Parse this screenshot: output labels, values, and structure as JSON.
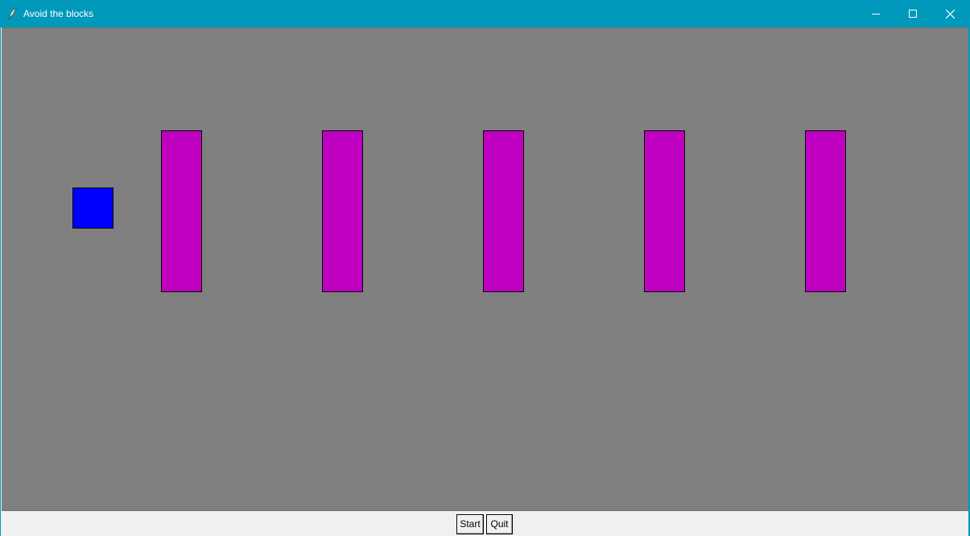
{
  "window": {
    "title": "Avoid the blocks",
    "titlebar_color": "#0099bc",
    "controls": {
      "minimize_icon": "minimize-icon",
      "maximize_icon": "maximize-icon",
      "close_icon": "close-icon"
    }
  },
  "game": {
    "background_color": "#808080",
    "player": {
      "color": "#0000ff"
    },
    "blocks": {
      "count": 5,
      "color": "#c000c0"
    }
  },
  "buttons": {
    "start_label": "Start",
    "quit_label": "Quit"
  }
}
